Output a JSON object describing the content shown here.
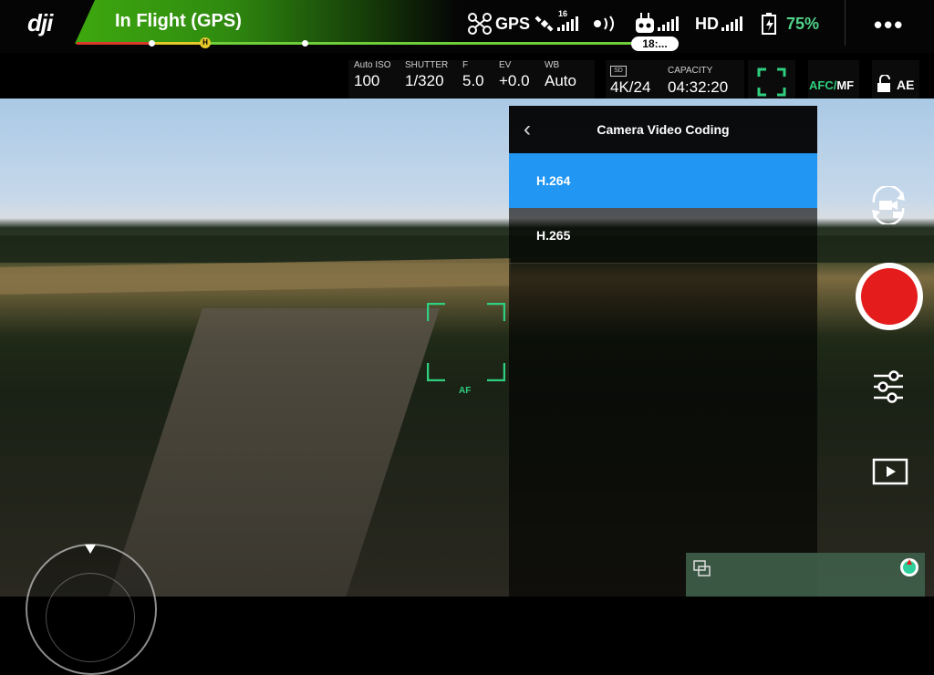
{
  "app": {
    "logo": "dji"
  },
  "status": {
    "flight_mode": "In Flight (GPS)",
    "battery_time": "18:...",
    "home_marker": "H",
    "gps_label": "GPS",
    "satellite_count": "16",
    "hd_label": "HD",
    "battery_percent": "75%",
    "menu_label": "•••"
  },
  "camera_params": [
    {
      "label": "Auto ISO",
      "value": "100"
    },
    {
      "label": "SHUTTER",
      "value": "1/320"
    },
    {
      "label": "F",
      "value": "5.0"
    },
    {
      "label": "EV",
      "value": "+0.0"
    },
    {
      "label": "WB",
      "value": "Auto"
    }
  ],
  "recording": {
    "sd_badge": "SD",
    "resolution": "4K/24",
    "capacity_label": "CAPACITY",
    "capacity_value": "04:32:20"
  },
  "focus": {
    "afc": "AFC",
    "separator": "/",
    "mf": "MF",
    "ae": "AE",
    "af_label": "AF"
  },
  "panel": {
    "title": "Camera Video Coding",
    "back_icon": "‹",
    "options": [
      {
        "label": "H.264",
        "selected": true
      },
      {
        "label": "H.265",
        "selected": false
      }
    ]
  },
  "colors": {
    "accent_blue": "#2196f3",
    "focus_green": "#2ecf7e",
    "battery_green": "#52d48a",
    "record_red": "#e41c1c"
  }
}
